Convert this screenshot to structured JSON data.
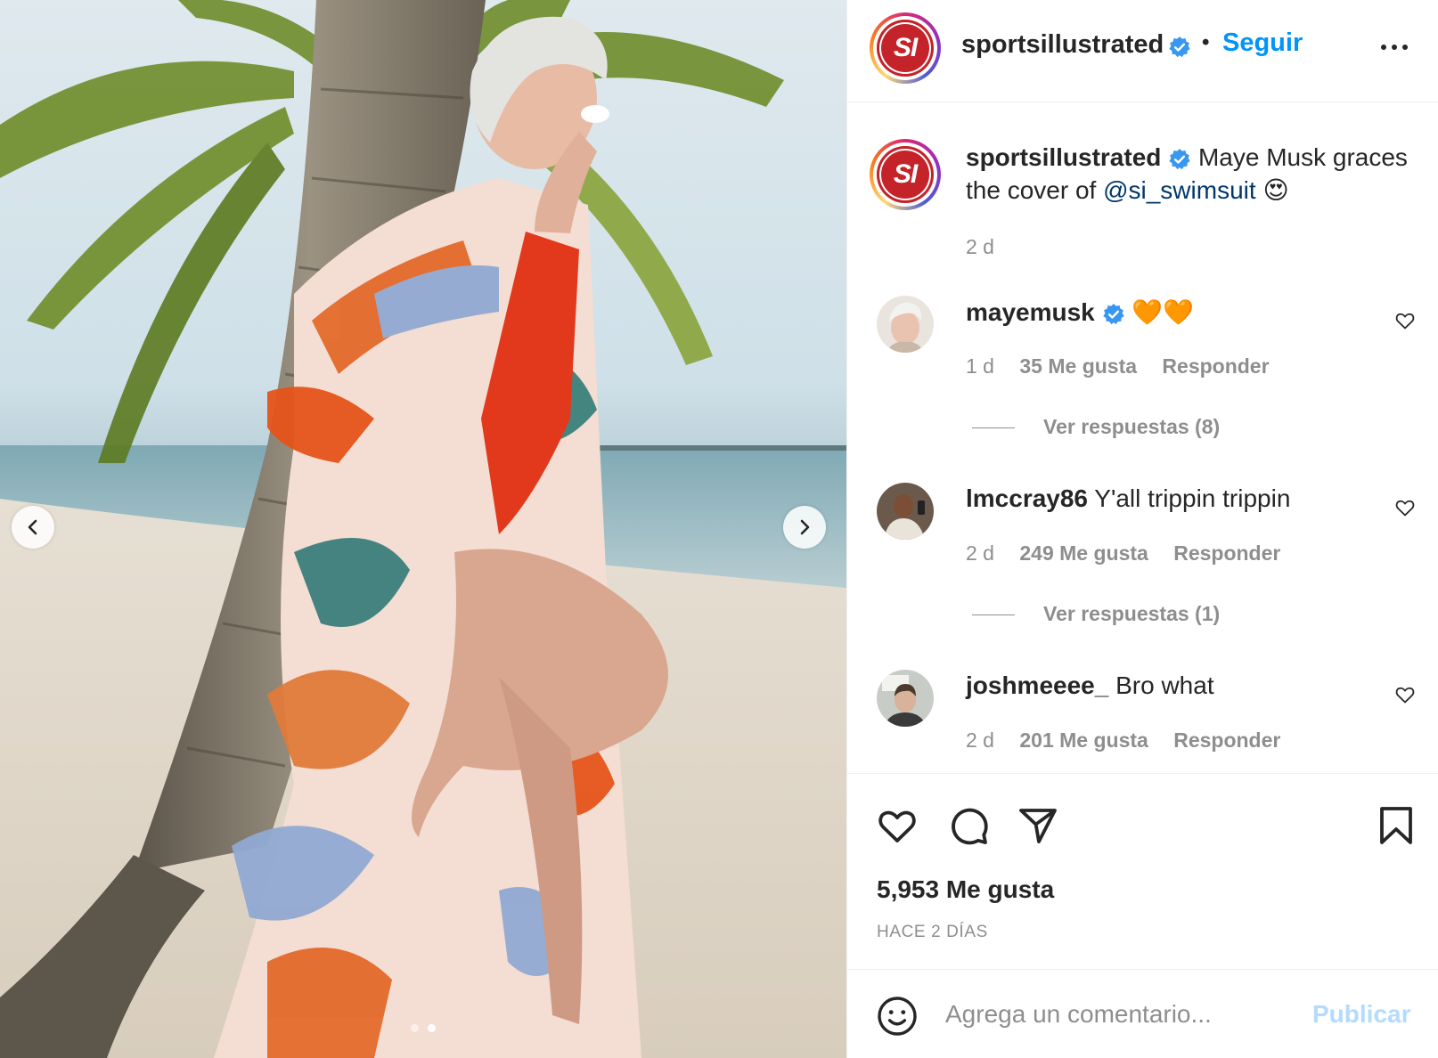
{
  "post": {
    "username": "sportsillustrated",
    "follow_label": "Seguir",
    "separator": "•",
    "avatar_text": "SI"
  },
  "caption": {
    "username": "sportsillustrated",
    "text_before": "Maye Musk graces the cover of ",
    "mention": "@si_swimsuit",
    "emoji": "😍",
    "time": "2 d"
  },
  "comments": [
    {
      "username": "mayemusk",
      "verified": true,
      "text": "🧡🧡",
      "time": "1 d",
      "likes": "35 Me gusta",
      "reply_label": "Responder",
      "replies_label": "Ver respuestas (8)"
    },
    {
      "username": "lmccray86",
      "verified": false,
      "text": "Y'all trippin trippin",
      "time": "2 d",
      "likes": "249 Me gusta",
      "reply_label": "Responder",
      "replies_label": "Ver respuestas (1)"
    },
    {
      "username": "joshmeeee_",
      "verified": false,
      "text": "Bro what",
      "time": "2 d",
      "likes": "201 Me gusta",
      "reply_label": "Responder"
    }
  ],
  "stats": {
    "likes": "5,953 Me gusta",
    "date": "HACE 2 DÍAS"
  },
  "composer": {
    "placeholder": "Agrega un comentario...",
    "publish_label": "Publicar"
  },
  "carousel": {
    "slides": 2,
    "active": 2
  },
  "colors": {
    "accent": "#0095f6",
    "verified": "#3897f0",
    "si_red": "#c4232a",
    "mention": "#00376b",
    "muted": "#8e8e8e",
    "publish_disabled": "#b3dbff"
  },
  "icons": [
    "verified-badge-icon",
    "more-options-icon",
    "heart-icon",
    "comment-icon",
    "share-icon",
    "bookmark-icon",
    "emoji-icon",
    "chevron-left-icon",
    "chevron-right-icon"
  ]
}
